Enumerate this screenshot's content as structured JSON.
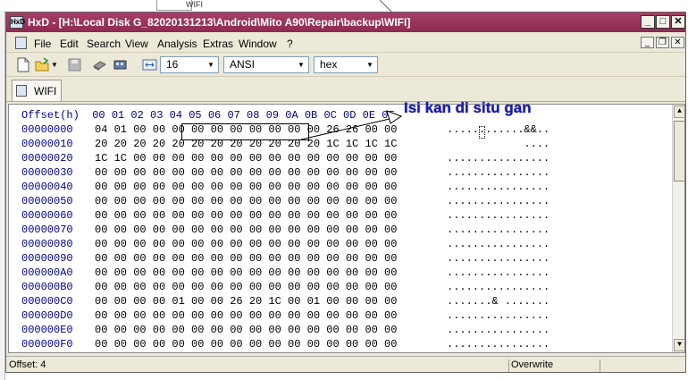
{
  "background": {
    "item_label": "WIFI"
  },
  "window": {
    "title": "HxD - [H:\\Local Disk G_82020131213\\Android\\Mito A90\\Repair\\backup\\WIFI]",
    "app_icon_text": "HxD",
    "title_color": "#8e2a52"
  },
  "menu": {
    "items": [
      "File",
      "Edit",
      "Search",
      "View",
      "Analysis",
      "Extras",
      "Window",
      "?"
    ]
  },
  "toolbar": {
    "bytes_per_row": "16",
    "charset": "ANSI",
    "offset_base": "hex"
  },
  "tab": {
    "label": "WIFI"
  },
  "editor": {
    "header": "Offset(h)  00 01 02 03 04 05 06 07 08 09 0A 0B 0C 0D 0E 0F",
    "rows": [
      {
        "offset": "00000000",
        "hex": "04 01 00 00 00 00 00 00 00 00 00 00 26 26 00 00",
        "ascii": "............&&.."
      },
      {
        "offset": "00000010",
        "hex": "20 20 20 20 20 20 20 20 20 20 20 20 1C 1C 1C 1C",
        "ascii": "            ...."
      },
      {
        "offset": "00000020",
        "hex": "1C 1C 00 00 00 00 00 00 00 00 00 00 00 00 00 00",
        "ascii": "................"
      },
      {
        "offset": "00000030",
        "hex": "00 00 00 00 00 00 00 00 00 00 00 00 00 00 00 00",
        "ascii": "................"
      },
      {
        "offset": "00000040",
        "hex": "00 00 00 00 00 00 00 00 00 00 00 00 00 00 00 00",
        "ascii": "................"
      },
      {
        "offset": "00000050",
        "hex": "00 00 00 00 00 00 00 00 00 00 00 00 00 00 00 00",
        "ascii": "................"
      },
      {
        "offset": "00000060",
        "hex": "00 00 00 00 00 00 00 00 00 00 00 00 00 00 00 00",
        "ascii": "................"
      },
      {
        "offset": "00000070",
        "hex": "00 00 00 00 00 00 00 00 00 00 00 00 00 00 00 00",
        "ascii": "................"
      },
      {
        "offset": "00000080",
        "hex": "00 00 00 00 00 00 00 00 00 00 00 00 00 00 00 00",
        "ascii": "................"
      },
      {
        "offset": "00000090",
        "hex": "00 00 00 00 00 00 00 00 00 00 00 00 00 00 00 00",
        "ascii": "................"
      },
      {
        "offset": "000000A0",
        "hex": "00 00 00 00 00 00 00 00 00 00 00 00 00 00 00 00",
        "ascii": "................"
      },
      {
        "offset": "000000B0",
        "hex": "00 00 00 00 00 00 00 00 00 00 00 00 00 00 00 00",
        "ascii": "................"
      },
      {
        "offset": "000000C0",
        "hex": "00 00 00 00 01 00 00 26 20 1C 00 01 00 00 00 00",
        "ascii": ".......& ......."
      },
      {
        "offset": "000000D0",
        "hex": "00 00 00 00 00 00 00 00 00 00 00 00 00 00 00 00",
        "ascii": "................"
      },
      {
        "offset": "000000E0",
        "hex": "00 00 00 00 00 00 00 00 00 00 00 00 00 00 00 00",
        "ascii": "................"
      },
      {
        "offset": "000000F0",
        "hex": "00 00 00 00 00 00 00 00 00 00 00 00 00 00 00 00",
        "ascii": "................"
      }
    ]
  },
  "annotation": {
    "text": "Isi kan di situ gan",
    "color": "#1a1aa8"
  },
  "status": {
    "offset": "Offset: 4",
    "mode": "Overwrite"
  }
}
